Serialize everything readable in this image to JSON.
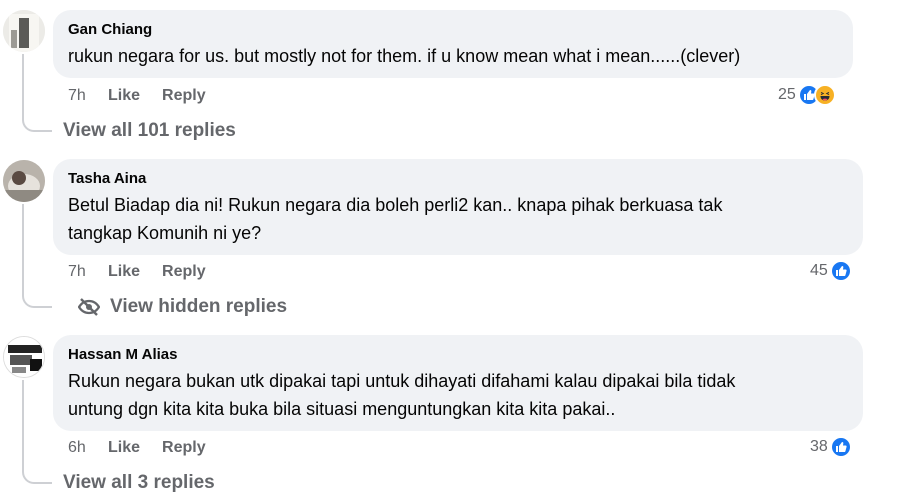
{
  "comments": [
    {
      "author": "Gan Chiang",
      "text_lines": [
        "rukun negara for us. but mostly not for them. if u know mean what i mean......(clever)"
      ],
      "time": "7h",
      "like_label": "Like",
      "reply_label": "Reply",
      "reaction_count": "25",
      "reactions": [
        "like-icon",
        "haha-icon"
      ],
      "replies_label": "View all 101 replies"
    },
    {
      "author": "Tasha Aina",
      "text_lines": [
        "Betul Biadap dia ni! Rukun negara dia boleh perli2 kan.. knapa pihak berkuasa tak",
        "tangkap Komunih ni ye?"
      ],
      "time": "7h",
      "like_label": "Like",
      "reply_label": "Reply",
      "reaction_count": "45",
      "reactions": [
        "like-icon"
      ],
      "replies_label": "View hidden replies"
    },
    {
      "author": "Hassan M Alias",
      "text_lines": [
        "Rukun negara bukan utk dipakai tapi untuk dihayati difahami kalau dipakai bila tidak",
        "untung dgn kita kita buka bila situasi menguntungkan kita kita pakai.."
      ],
      "time": "6h",
      "like_label": "Like",
      "reply_label": "Reply",
      "reaction_count": "38",
      "reactions": [
        "like-icon"
      ],
      "replies_label": "View all 3 replies"
    }
  ],
  "colors": {
    "bubble": "#f0f2f5",
    "secondary_text": "#65676b",
    "like_blue": "#1877f2",
    "haha_yellow": "#f7b125"
  }
}
